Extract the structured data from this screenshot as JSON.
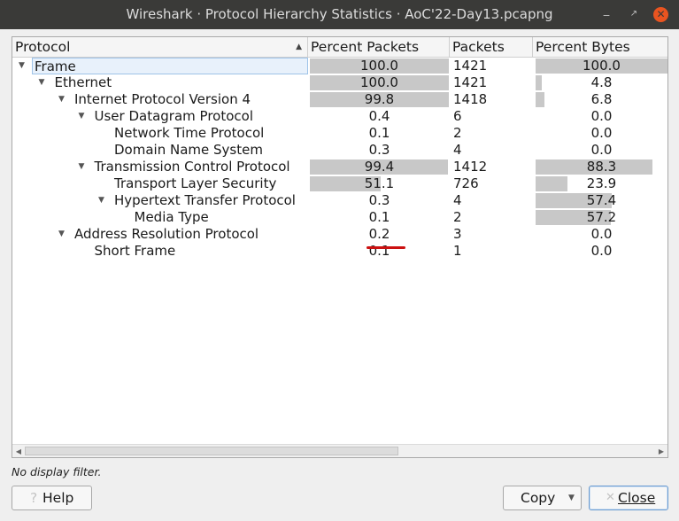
{
  "window": {
    "title": "Wireshark · Protocol Hierarchy Statistics · AoC'22-Day13.pcapng",
    "minimize_icon": "minimize-icon",
    "maximize_icon": "maximize-icon",
    "close_icon": "close-icon"
  },
  "table": {
    "columns": [
      "Protocol",
      "Percent Packets",
      "Packets",
      "Percent Bytes"
    ],
    "sorted_column": "Protocol",
    "rows": [
      {
        "protocol": "Frame",
        "percent_packets": "100.0",
        "packets": "1421",
        "percent_bytes": "100.0",
        "expanded": true,
        "selected": true
      },
      {
        "protocol": "Ethernet",
        "percent_packets": "100.0",
        "packets": "1421",
        "percent_bytes": "4.8",
        "expanded": true
      },
      {
        "protocol": "Internet Protocol Version 4",
        "percent_packets": "99.8",
        "packets": "1418",
        "percent_bytes": "6.8",
        "expanded": true
      },
      {
        "protocol": "User Datagram Protocol",
        "percent_packets": "0.4",
        "packets": "6",
        "percent_bytes": "0.0",
        "expanded": true
      },
      {
        "protocol": "Network Time Protocol",
        "percent_packets": "0.1",
        "packets": "2",
        "percent_bytes": "0.0"
      },
      {
        "protocol": "Domain Name System",
        "percent_packets": "0.3",
        "packets": "4",
        "percent_bytes": "0.0"
      },
      {
        "protocol": "Transmission Control Protocol",
        "percent_packets": "99.4",
        "packets": "1412",
        "percent_bytes": "88.3",
        "expanded": true
      },
      {
        "protocol": "Transport Layer Security",
        "percent_packets": "51.1",
        "packets": "726",
        "percent_bytes": "23.9"
      },
      {
        "protocol": "Hypertext Transfer Protocol",
        "percent_packets": "0.3",
        "packets": "4",
        "percent_bytes": "57.4",
        "expanded": true
      },
      {
        "protocol": "Media Type",
        "percent_packets": "0.1",
        "packets": "2",
        "percent_bytes": "57.2"
      },
      {
        "protocol": "Address Resolution Protocol",
        "percent_packets": "0.2",
        "packets": "3",
        "percent_bytes": "0.0",
        "expanded": true
      },
      {
        "protocol": "Short Frame",
        "percent_packets": "0.1",
        "packets": "1",
        "percent_bytes": "0.0"
      }
    ]
  },
  "status": {
    "filter_text": "No display filter."
  },
  "buttons": {
    "help": "Help",
    "copy": "Copy",
    "close": "Close"
  },
  "colors": {
    "bar": "#c8c8c8",
    "annotation": "#cc1111",
    "titlebar": "#3a3a38",
    "close_button": "#e95420"
  }
}
